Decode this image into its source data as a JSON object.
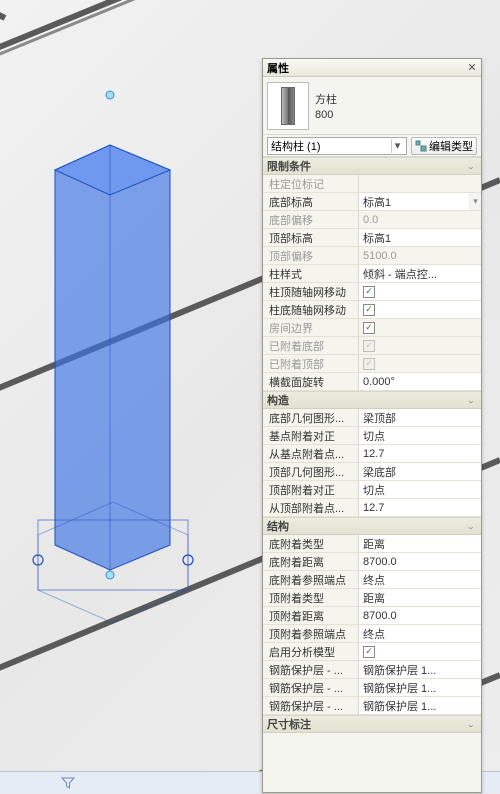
{
  "panel": {
    "title": "属性",
    "family_name": "方柱",
    "type_name": "800",
    "instance_selector": "结构柱 (1)",
    "edit_type_label": "编辑类型"
  },
  "sections": {
    "constraints": {
      "title": "限制条件",
      "rows": [
        {
          "name": "柱定位标记",
          "value": "",
          "ro": true
        },
        {
          "name": "底部标高",
          "value": "标高1",
          "dd": true
        },
        {
          "name": "底部偏移",
          "value": "0.0",
          "ro": true
        },
        {
          "name": "顶部标高",
          "value": "标高1"
        },
        {
          "name": "顶部偏移",
          "value": "5100.0",
          "ro": true
        },
        {
          "name": "柱样式",
          "value": "倾斜 - 端点控..."
        },
        {
          "name": "柱顶随轴网移动",
          "cb": true,
          "checked": true
        },
        {
          "name": "柱底随轴网移动",
          "cb": true,
          "checked": true
        },
        {
          "name": "房间边界",
          "cb": true,
          "checked": true,
          "ro": true
        },
        {
          "name": "已附着底部",
          "cb": true,
          "checked": true,
          "ro": true,
          "dis": true
        },
        {
          "name": "已附着顶部",
          "cb": true,
          "checked": true,
          "ro": true,
          "dis": true
        },
        {
          "name": "横截面旋转",
          "value": "0.000°"
        }
      ]
    },
    "construction": {
      "title": "构造",
      "rows": [
        {
          "name": "底部几何图形...",
          "value": "梁顶部"
        },
        {
          "name": "基点附着对正",
          "value": "切点"
        },
        {
          "name": "从基点附着点...",
          "value": "12.7"
        },
        {
          "name": "顶部几何图形...",
          "value": "梁底部"
        },
        {
          "name": "顶部附着对正",
          "value": "切点"
        },
        {
          "name": "从顶部附着点...",
          "value": "12.7"
        }
      ]
    },
    "structural": {
      "title": "结构",
      "rows": [
        {
          "name": "底附着类型",
          "value": "距离"
        },
        {
          "name": "底附着距离",
          "value": "8700.0"
        },
        {
          "name": "底附着参照端点",
          "value": "终点"
        },
        {
          "name": "顶附着类型",
          "value": "距离"
        },
        {
          "name": "顶附着距离",
          "value": "8700.0"
        },
        {
          "name": "顶附着参照端点",
          "value": "终点"
        },
        {
          "name": "启用分析模型",
          "cb": true,
          "checked": true
        },
        {
          "name": "钢筋保护层 - ...",
          "value": "钢筋保护层 1..."
        },
        {
          "name": "钢筋保护层 - ...",
          "value": "钢筋保护层 1..."
        },
        {
          "name": "钢筋保护层 - ...",
          "value": "钢筋保护层 1..."
        }
      ]
    },
    "dimensions": {
      "title": "尺寸标注"
    }
  }
}
